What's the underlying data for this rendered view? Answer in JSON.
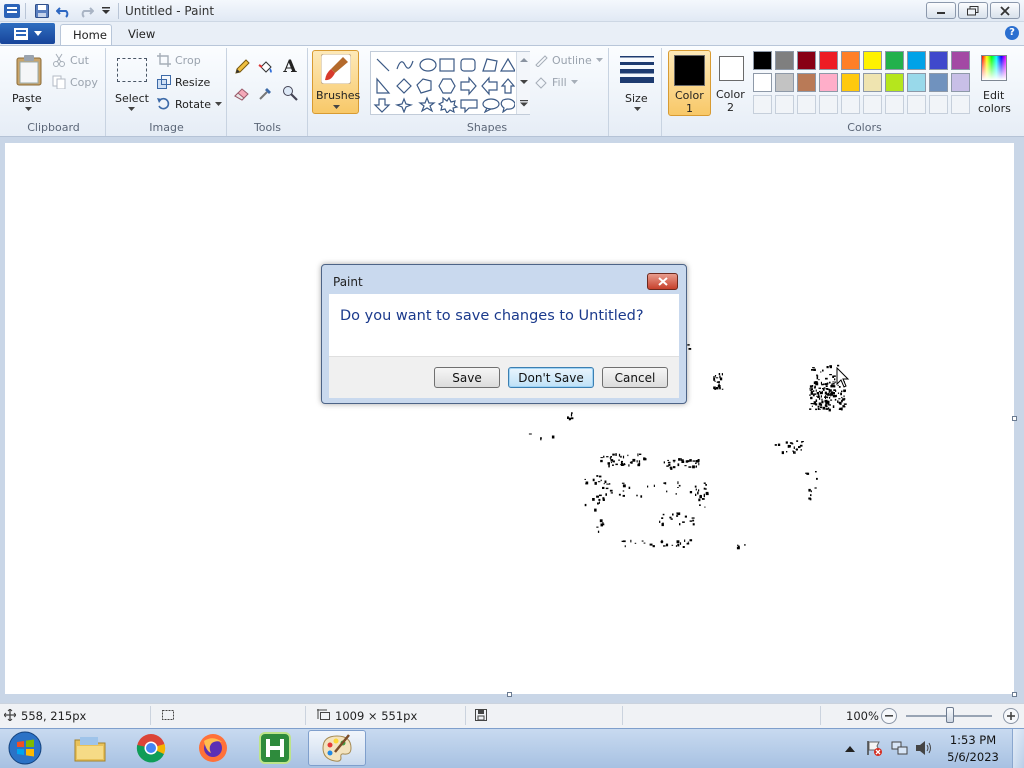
{
  "window": {
    "title": "Untitled - Paint"
  },
  "tabs": [
    {
      "label": "Home"
    },
    {
      "label": "View"
    }
  ],
  "ribbon": {
    "clipboard": {
      "paste": "Paste",
      "cut": "Cut",
      "copy": "Copy",
      "group": "Clipboard"
    },
    "image": {
      "select": "Select",
      "crop": "Crop",
      "resize": "Resize",
      "rotate": "Rotate",
      "group": "Image"
    },
    "tools": {
      "group": "Tools",
      "text_tool": "A"
    },
    "brushes": {
      "label": "Brushes"
    },
    "shapes": {
      "outline": "Outline",
      "fill": "Fill",
      "group": "Shapes"
    },
    "size": {
      "label": "Size"
    },
    "color1": {
      "line1": "Color",
      "line2": "1",
      "value": "#000000"
    },
    "color2": {
      "line1": "Color",
      "line2": "2",
      "value": "#ffffff"
    },
    "colors": {
      "group": "Colors",
      "edit_line1": "Edit",
      "edit_line2": "colors",
      "row1": [
        "#000000",
        "#7f7f7f",
        "#880015",
        "#ed1c24",
        "#ff7f27",
        "#fff200",
        "#22b14c",
        "#00a2e8",
        "#3f48cc",
        "#a349a4"
      ],
      "row2": [
        "#ffffff",
        "#c3c3c3",
        "#b97a57",
        "#ffaec9",
        "#ffc90e",
        "#efe4b0",
        "#b5e61d",
        "#99d9ea",
        "#7092be",
        "#c8bfe7"
      ]
    }
  },
  "status": {
    "cursor_pos": "558, 215px",
    "canvas_size": "1009 × 551px",
    "zoom": "100%"
  },
  "taskbar": {
    "time": "1:53 PM",
    "date": "5/6/2023"
  },
  "dialog": {
    "title": "Paint",
    "message": "Do you want to save changes to Untitled?",
    "save": "Save",
    "dont_save": "Don't Save",
    "cancel": "Cancel"
  }
}
